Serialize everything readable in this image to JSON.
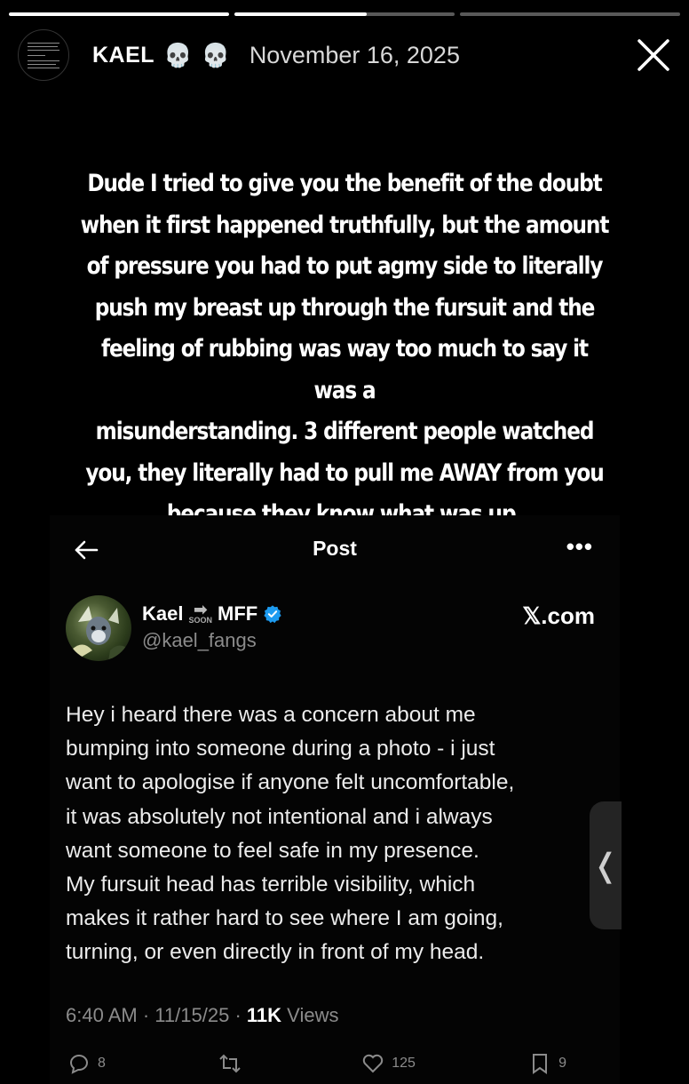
{
  "story": {
    "progress": [
      1.0,
      0.6,
      0.0
    ]
  },
  "header": {
    "username": "KAEL",
    "emoji": [
      "💀",
      "💀"
    ],
    "date": "November 16, 2025",
    "avatar_icon": "screenshot-thumbnail",
    "close_icon": "close-icon"
  },
  "caption": {
    "text": "Dude I tried to give you the benefit of the doubt\nwhen it first happened truthfully, but the amount\nof pressure you had to put agmy side to literally\npush my breast up through the fursuit and the\nfeeling of rubbing was way too much to say it was a\nmisunderstanding. 3 different people watched\nyou, they literally had to pull me AWAY from you\nbecause they know what was up."
  },
  "post": {
    "title": "Post",
    "back_icon": "back-arrow-icon",
    "more_icon": "more-icon",
    "author": {
      "name": "Kael",
      "arrow": "➡",
      "soon": "SOON",
      "name_suffix": "MFF",
      "handle": "@kael_fangs",
      "verified_color": "#1d9bf0"
    },
    "source": "𝕏.com",
    "body": "Hey i heard there was a concern about me\nbumping into someone during a photo - i just\nwant to apologise if anyone felt uncomfortable,\nit was absolutely not intentional and  i always\nwant someone to feel safe in my presence.\nMy fursuit head has terrible visibility, which\nmakes it rather hard to see where I am going,\nturning, or even directly in front of my head.",
    "time": "6:40 AM",
    "date": "11/15/25",
    "views_count": "11K",
    "views_label": "Views",
    "actions": {
      "reply_count": "8",
      "repost_count": "",
      "like_count": "125",
      "bookmark_count": "9"
    }
  },
  "side_tab": {
    "glyph": "❬"
  }
}
